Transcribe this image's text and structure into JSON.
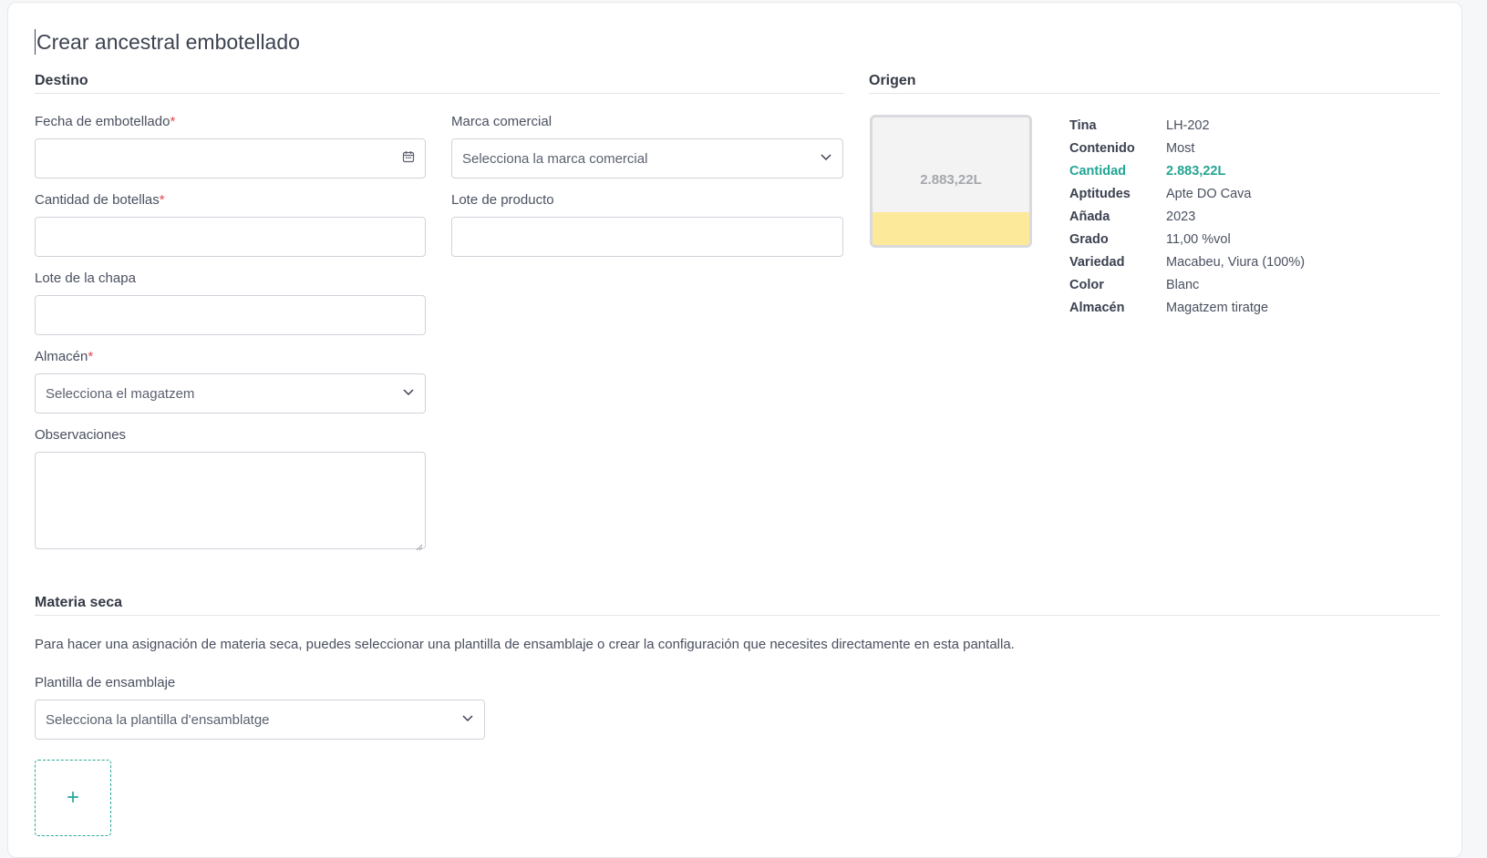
{
  "page": {
    "title": "Crear ancestral embotellado"
  },
  "destino": {
    "title": "Destino",
    "fecha_label": "Fecha de embotellado",
    "cantidad_label": "Cantidad de botellas",
    "chapa_label": "Lote de la chapa",
    "almacen_label": "Almacén",
    "almacen_placeholder": "Selecciona el magatzem",
    "observaciones_label": "Observaciones",
    "marca_label": "Marca comercial",
    "marca_placeholder": "Selecciona la marca comercial",
    "lote_producto_label": "Lote de producto",
    "required_mark": "*"
  },
  "origen": {
    "title": "Origen",
    "tank_label": "2.883,22L",
    "fill_fraction": 0.26,
    "properties": [
      {
        "key": "Tina",
        "value": "LH-202",
        "accent": false
      },
      {
        "key": "Contenido",
        "value": "Most",
        "accent": false
      },
      {
        "key": "Cantidad",
        "value": "2.883,22L",
        "accent": true
      },
      {
        "key": "Aptitudes",
        "value": "Apte DO Cava",
        "accent": false
      },
      {
        "key": "Añada",
        "value": "2023",
        "accent": false
      },
      {
        "key": "Grado",
        "value": "11,00 %vol",
        "accent": false
      },
      {
        "key": "Variedad",
        "value": "Macabeu, Viura (100%)",
        "accent": false
      },
      {
        "key": "Color",
        "value": "Blanc",
        "accent": false
      },
      {
        "key": "Almacén",
        "value": "Magatzem tiratge",
        "accent": false
      }
    ]
  },
  "materia": {
    "title": "Materia seca",
    "description": "Para hacer una asignación de materia seca, puedes seleccionar una plantilla de ensamblaje o crear la configuración que necesites directamente en esta pantalla.",
    "plantilla_label": "Plantilla de ensamblaje",
    "plantilla_placeholder": "Selecciona la plantilla d'ensamblatge",
    "add_symbol": "+"
  },
  "colors": {
    "accent": "#22a593",
    "required": "#e5484d",
    "tank_fill": "#fde99a"
  },
  "icons": {
    "calendar": "calendar-icon",
    "chevron": "chevron-down-icon",
    "add": "plus-icon"
  }
}
